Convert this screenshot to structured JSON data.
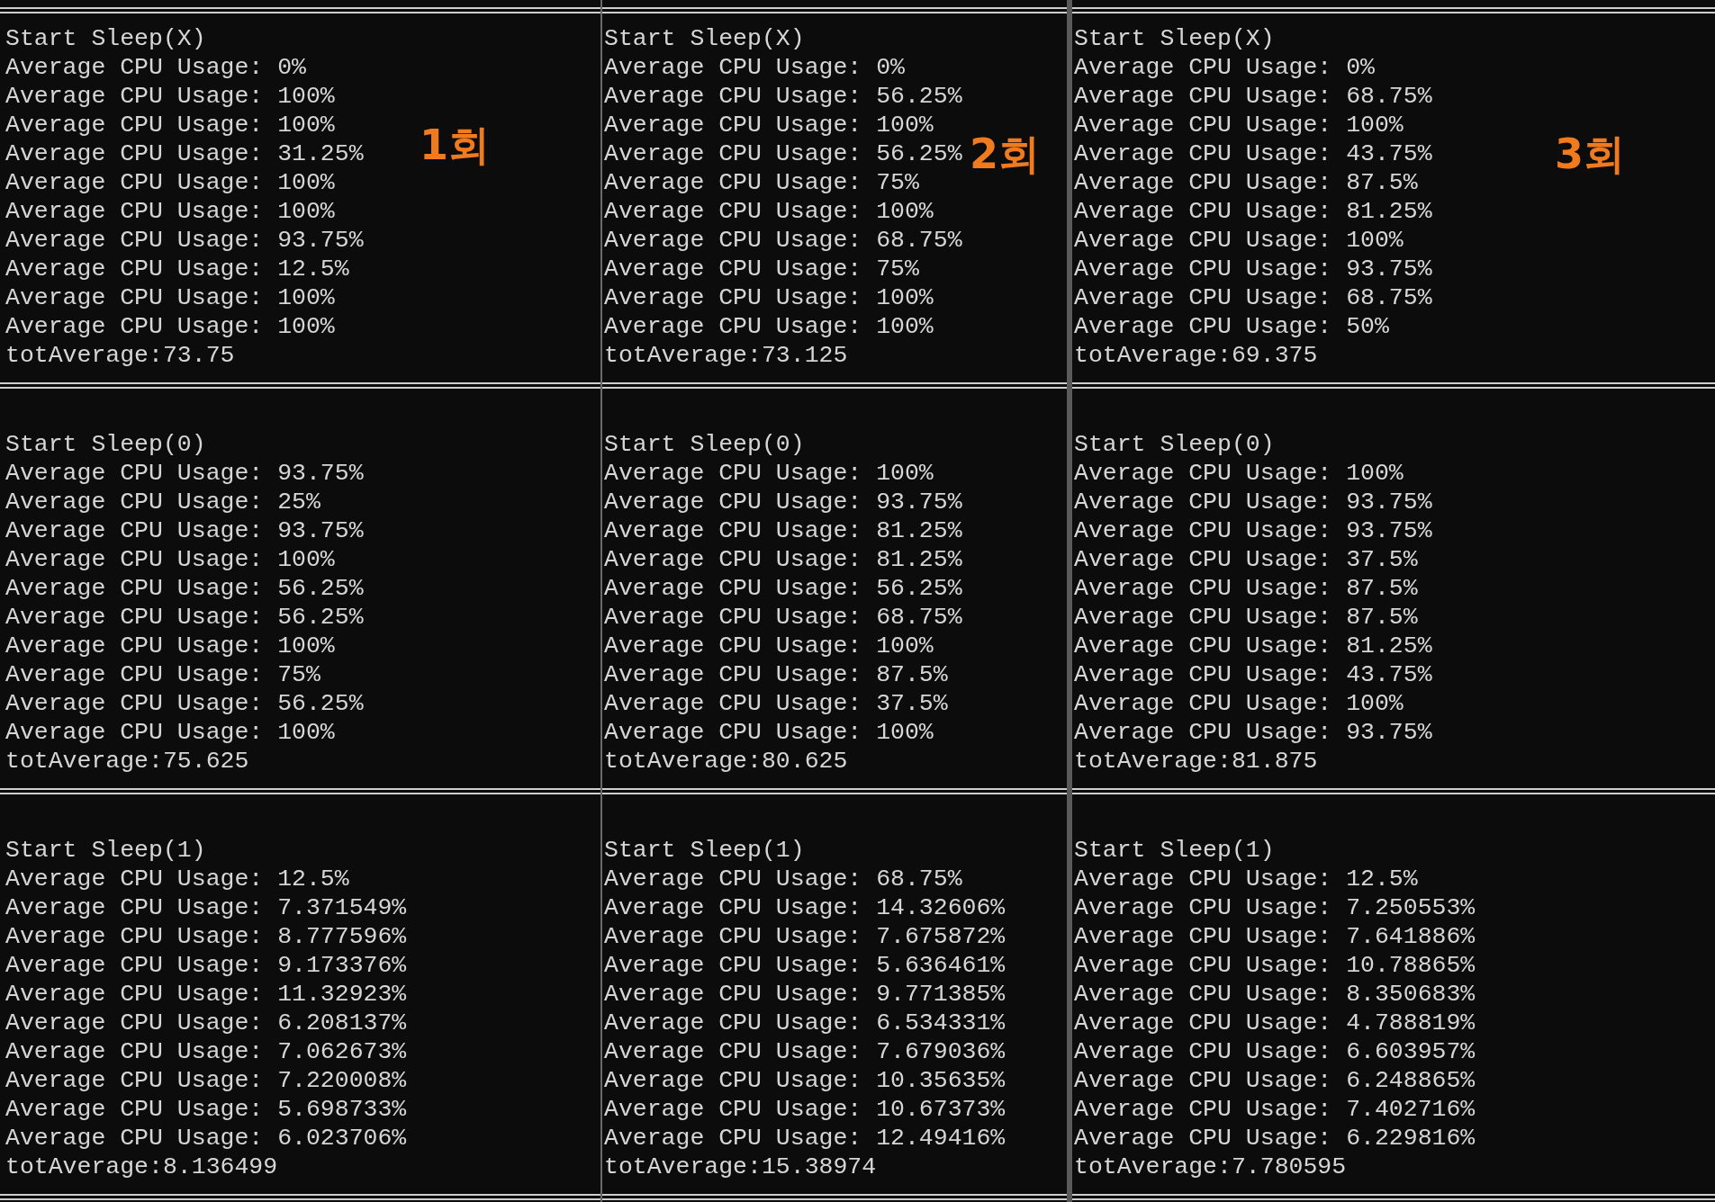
{
  "columns": [
    {
      "label": "1회",
      "blocks": [
        {
          "title": "Start Sleep(X)",
          "lines": [
            "Average CPU Usage: 0%",
            "Average CPU Usage: 100%",
            "Average CPU Usage: 100%",
            "Average CPU Usage: 31.25%",
            "Average CPU Usage: 100%",
            "Average CPU Usage: 100%",
            "Average CPU Usage: 93.75%",
            "Average CPU Usage: 12.5%",
            "Average CPU Usage: 100%",
            "Average CPU Usage: 100%"
          ],
          "total": "totAverage:73.75"
        },
        {
          "title": "Start Sleep(0)",
          "lines": [
            "Average CPU Usage: 93.75%",
            "Average CPU Usage: 25%",
            "Average CPU Usage: 93.75%",
            "Average CPU Usage: 100%",
            "Average CPU Usage: 56.25%",
            "Average CPU Usage: 56.25%",
            "Average CPU Usage: 100%",
            "Average CPU Usage: 75%",
            "Average CPU Usage: 56.25%",
            "Average CPU Usage: 100%"
          ],
          "total": "totAverage:75.625"
        },
        {
          "title": "Start Sleep(1)",
          "lines": [
            "Average CPU Usage: 12.5%",
            "Average CPU Usage: 7.371549%",
            "Average CPU Usage: 8.777596%",
            "Average CPU Usage: 9.173376%",
            "Average CPU Usage: 11.32923%",
            "Average CPU Usage: 6.208137%",
            "Average CPU Usage: 7.062673%",
            "Average CPU Usage: 7.220008%",
            "Average CPU Usage: 5.698733%",
            "Average CPU Usage: 6.023706%"
          ],
          "total": "totAverage:8.136499"
        }
      ]
    },
    {
      "label": "2회",
      "blocks": [
        {
          "title": "Start Sleep(X)",
          "lines": [
            "Average CPU Usage: 0%",
            "Average CPU Usage: 56.25%",
            "Average CPU Usage: 100%",
            "Average CPU Usage: 56.25%",
            "Average CPU Usage: 75%",
            "Average CPU Usage: 100%",
            "Average CPU Usage: 68.75%",
            "Average CPU Usage: 75%",
            "Average CPU Usage: 100%",
            "Average CPU Usage: 100%"
          ],
          "total": "totAverage:73.125"
        },
        {
          "title": "Start Sleep(0)",
          "lines": [
            "Average CPU Usage: 100%",
            "Average CPU Usage: 93.75%",
            "Average CPU Usage: 81.25%",
            "Average CPU Usage: 81.25%",
            "Average CPU Usage: 56.25%",
            "Average CPU Usage: 68.75%",
            "Average CPU Usage: 100%",
            "Average CPU Usage: 87.5%",
            "Average CPU Usage: 37.5%",
            "Average CPU Usage: 100%"
          ],
          "total": "totAverage:80.625"
        },
        {
          "title": "Start Sleep(1)",
          "lines": [
            "Average CPU Usage: 68.75%",
            "Average CPU Usage: 14.32606%",
            "Average CPU Usage: 7.675872%",
            "Average CPU Usage: 5.636461%",
            "Average CPU Usage: 9.771385%",
            "Average CPU Usage: 6.534331%",
            "Average CPU Usage: 7.679036%",
            "Average CPU Usage: 10.35635%",
            "Average CPU Usage: 10.67373%",
            "Average CPU Usage: 12.49416%"
          ],
          "total": "totAverage:15.38974"
        }
      ]
    },
    {
      "label": "3회",
      "blocks": [
        {
          "title": "Start Sleep(X)",
          "lines": [
            "Average CPU Usage: 0%",
            "Average CPU Usage: 68.75%",
            "Average CPU Usage: 100%",
            "Average CPU Usage: 43.75%",
            "Average CPU Usage: 87.5%",
            "Average CPU Usage: 81.25%",
            "Average CPU Usage: 100%",
            "Average CPU Usage: 93.75%",
            "Average CPU Usage: 68.75%",
            "Average CPU Usage: 50%"
          ],
          "total": "totAverage:69.375"
        },
        {
          "title": "Start Sleep(0)",
          "lines": [
            "Average CPU Usage: 100%",
            "Average CPU Usage: 93.75%",
            "Average CPU Usage: 93.75%",
            "Average CPU Usage: 37.5%",
            "Average CPU Usage: 87.5%",
            "Average CPU Usage: 87.5%",
            "Average CPU Usage: 81.25%",
            "Average CPU Usage: 43.75%",
            "Average CPU Usage: 100%",
            "Average CPU Usage: 93.75%"
          ],
          "total": "totAverage:81.875"
        },
        {
          "title": "Start Sleep(1)",
          "lines": [
            "Average CPU Usage: 12.5%",
            "Average CPU Usage: 7.250553%",
            "Average CPU Usage: 7.641886%",
            "Average CPU Usage: 10.78865%",
            "Average CPU Usage: 8.350683%",
            "Average CPU Usage: 4.788819%",
            "Average CPU Usage: 6.603957%",
            "Average CPU Usage: 6.248865%",
            "Average CPU Usage: 7.402716%",
            "Average CPU Usage: 6.229816%"
          ],
          "total": "totAverage:7.780595"
        }
      ]
    }
  ]
}
